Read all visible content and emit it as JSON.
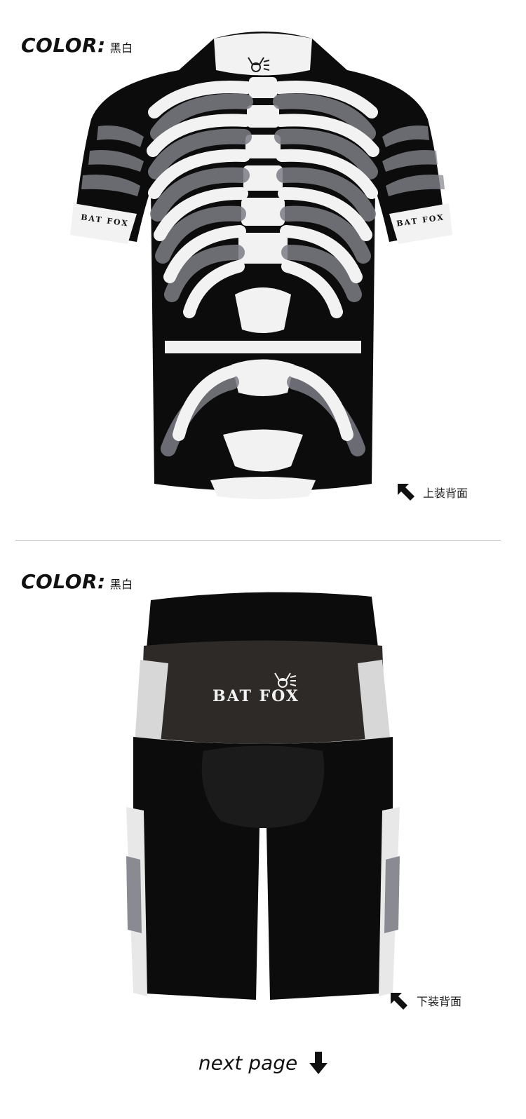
{
  "top": {
    "color_label": "COLOR:",
    "color_value": "黑白",
    "caption": "上装背面",
    "brand_collar_left": "BAT FOX",
    "brand_collar_right": "BAT FOX"
  },
  "bottom": {
    "color_label": "COLOR:",
    "color_value": "黑白",
    "caption": "下装背面",
    "brand_waist": "BAT FOX"
  },
  "footer": {
    "next_page": "next page"
  },
  "colors": {
    "black": "#0c0c0c",
    "grey": "#8a8a93",
    "white": "#f2f2f2",
    "divider": "#bdbdbd"
  },
  "icons": [
    "arrow-nw-icon",
    "arrow-down-icon",
    "bat-fox-logo"
  ]
}
